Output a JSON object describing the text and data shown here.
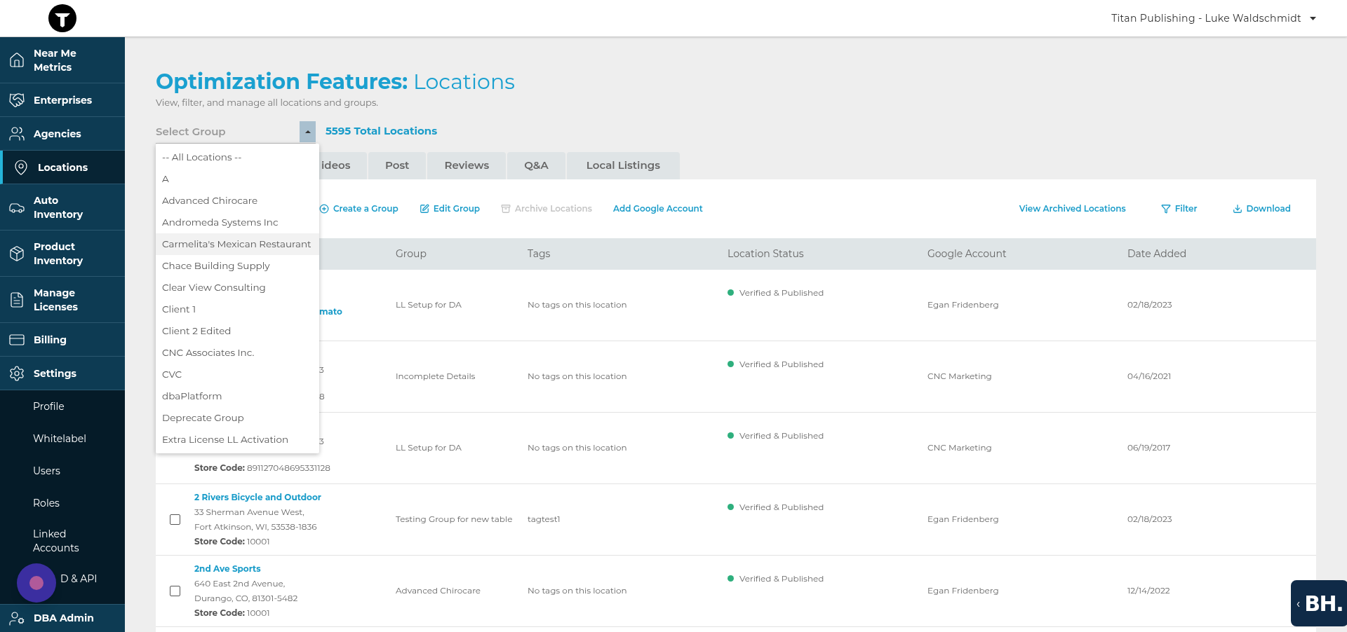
{
  "header": {
    "account": "Titan Publishing - Luke Waldschmidt"
  },
  "sidebar": {
    "items": [
      {
        "label": "Near Me Metrics",
        "selected": false
      },
      {
        "label": "Enterprises",
        "selected": false
      },
      {
        "label": "Agencies",
        "selected": false
      },
      {
        "label": "Locations",
        "selected": true
      },
      {
        "label": "Auto Inventory",
        "selected": false
      },
      {
        "label": "Product Inventory",
        "selected": false
      },
      {
        "label": "Manage Licenses",
        "selected": false
      },
      {
        "label": "Billing",
        "selected": false
      },
      {
        "label": "Settings",
        "selected": false,
        "expanded": true,
        "children": [
          {
            "label": "Profile"
          },
          {
            "label": "Whitelabel"
          },
          {
            "label": "Users"
          },
          {
            "label": "Roles"
          },
          {
            "label": "Linked Accounts"
          },
          {
            "label": "D & API"
          }
        ]
      }
    ],
    "footer": {
      "label": "DBA Admin"
    }
  },
  "page": {
    "title_bold": "Optimization Features:",
    "title_light": "Locations",
    "subtitle": "View, filter, and manage all locations and groups.",
    "total": "5595 Total Locations"
  },
  "group_select": {
    "placeholder": "Select Group",
    "expanded": true,
    "options": [
      {
        "label": "-- All Locations --",
        "highlighted": false
      },
      {
        "label": "A",
        "highlighted": false
      },
      {
        "label": "Advanced Chirocare",
        "highlighted": false
      },
      {
        "label": "Andromeda Systems Inc",
        "highlighted": false
      },
      {
        "label": "Carmelita's Mexican Restaurant",
        "highlighted": true
      },
      {
        "label": "Chace Building Supply",
        "highlighted": false
      },
      {
        "label": "Clear View Consulting",
        "highlighted": false
      },
      {
        "label": "Client 1",
        "highlighted": false
      },
      {
        "label": "Client 2 Edited",
        "highlighted": false
      },
      {
        "label": "CNC Associates Inc.",
        "highlighted": false
      },
      {
        "label": "CVC",
        "highlighted": false
      },
      {
        "label": "dbaPlatform",
        "highlighted": false
      },
      {
        "label": "Deprecate Group",
        "highlighted": false
      },
      {
        "label": "Extra License LL Activation",
        "highlighted": false
      }
    ]
  },
  "tabs": [
    {
      "label": "ideos",
      "selected": false
    },
    {
      "label": "Post",
      "selected": false
    },
    {
      "label": "Reviews",
      "selected": false
    },
    {
      "label": "Q&A",
      "selected": false
    },
    {
      "label": "Local Listings",
      "selected": false
    }
  ],
  "toolbar": {
    "left": [
      {
        "label": "Create a Group",
        "disabled": false
      },
      {
        "label": "Edit Group",
        "disabled": false
      },
      {
        "label": "Archive Locations",
        "disabled": true
      },
      {
        "label": "Add Google Account",
        "disabled": false
      }
    ],
    "right": [
      {
        "label": "View Archived Locations",
        "disabled": false
      },
      {
        "label": "Filter",
        "disabled": false
      },
      {
        "label": "Download",
        "disabled": false
      }
    ]
  },
  "table": {
    "columns": [
      "Group",
      "Tags",
      "Location Status",
      "Google Account",
      "Date Added"
    ],
    "rows": [
      {
        "kind": "covered",
        "lines": [
          {
            "kind": "fragment",
            "text": "mato"
          }
        ],
        "group": "LL Setup for DA",
        "tags": "No tags on this location",
        "status": "Verified & Published",
        "account": "Egan Fridenberg",
        "date": "02/18/2023"
      },
      {
        "kind": "covered",
        "lines": [
          {
            "kind": "fragment",
            "text": "3"
          },
          {
            "kind": "fragment",
            "text": "8"
          }
        ],
        "group": "Incomplete Details",
        "tags": "No tags on this location",
        "status": "Verified & Published",
        "account": "CNC Marketing",
        "date": "04/16/2021"
      },
      {
        "kind": "covered",
        "lines": [
          {
            "kind": "fragment",
            "text": "3"
          },
          {
            "kind": "store",
            "label": "Store Code:",
            "text": "891127048695331128"
          }
        ],
        "group": "LL Setup for DA",
        "tags": "No tags on this location",
        "status": "Verified & Published",
        "account": "CNC Marketing",
        "date": "06/19/2017"
      },
      {
        "kind": "full",
        "checked": false,
        "lines": [
          {
            "kind": "name",
            "text": "2 Rivers Bicycle and Outdoor"
          },
          {
            "kind": "address",
            "text": "33 Sherman Avenue West,"
          },
          {
            "kind": "address",
            "text": "Fort Atkinson, WI, 53538-1836"
          },
          {
            "kind": "store",
            "label": "Store Code:",
            "text": "10001"
          }
        ],
        "group": "Testing Group for new table",
        "tags": "tagtest1",
        "status": "Verified & Published",
        "account": "Egan Fridenberg",
        "date": "02/18/2023"
      },
      {
        "kind": "full",
        "checked": false,
        "lines": [
          {
            "kind": "name",
            "text": "2nd Ave Sports"
          },
          {
            "kind": "address",
            "text": "640 East 2nd Avenue,"
          },
          {
            "kind": "address",
            "text": "Durango, CO, 81301-5482"
          },
          {
            "kind": "store",
            "label": "Store Code:",
            "text": "10001"
          }
        ],
        "group": "Advanced Chirocare",
        "tags": "No tags on this location",
        "status": "Verified & Published",
        "account": "Egan Fridenberg",
        "date": "12/14/2022"
      }
    ]
  },
  "badge": {
    "chevron": "‹",
    "text": "BH."
  }
}
